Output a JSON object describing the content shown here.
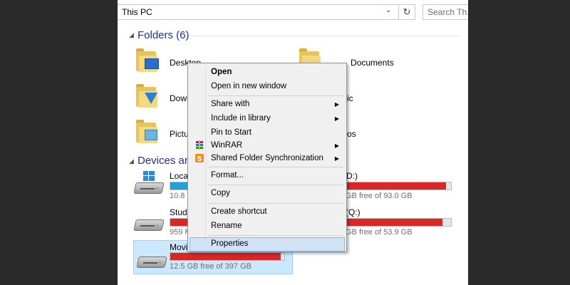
{
  "address_bar": {
    "path": "This PC",
    "search_placeholder": "Search Th..."
  },
  "sections": {
    "folders": {
      "title": "Folders (6)"
    },
    "devices": {
      "title": "Devices and"
    }
  },
  "folders": [
    {
      "label": "Desktop"
    },
    {
      "label": "Documents"
    },
    {
      "label": "Down"
    },
    {
      "label": "ic"
    },
    {
      "label": "Pictur"
    },
    {
      "label": "os"
    }
  ],
  "drives": [
    {
      "label": "Local",
      "free_text": "10.8 G",
      "fill_fraction": 0.88,
      "color": "#26a0da"
    },
    {
      "label": "D:)",
      "free_text": "GB free of 93.0 GB",
      "fill_fraction": 0.95,
      "color": "#da2626"
    },
    {
      "label": "Study",
      "free_text": "959 M",
      "fill_fraction": 0.97,
      "color": "#da2626"
    },
    {
      "label": "(Q:)",
      "free_text": "GB free of 53.9 GB",
      "fill_fraction": 0.92,
      "color": "#da2626"
    },
    {
      "label": "Movie",
      "free_text": "12.5 GB free of 397 GB",
      "fill_fraction": 0.97,
      "color": "#da2626"
    }
  ],
  "context_menu": {
    "open": "Open",
    "open_new_window": "Open in new window",
    "share_with": "Share with",
    "include_in_library": "Include in library",
    "pin_to_start": "Pin to Start",
    "winrar": "WinRAR",
    "shared_folder_sync": "Shared Folder Synchronization",
    "format": "Format...",
    "copy": "Copy",
    "create_shortcut": "Create shortcut",
    "rename": "Rename",
    "properties": "Properties",
    "submenu_arrow": "▶"
  },
  "icons": {
    "refresh": "↻",
    "chevron": "⌄",
    "collapse": "◢"
  }
}
